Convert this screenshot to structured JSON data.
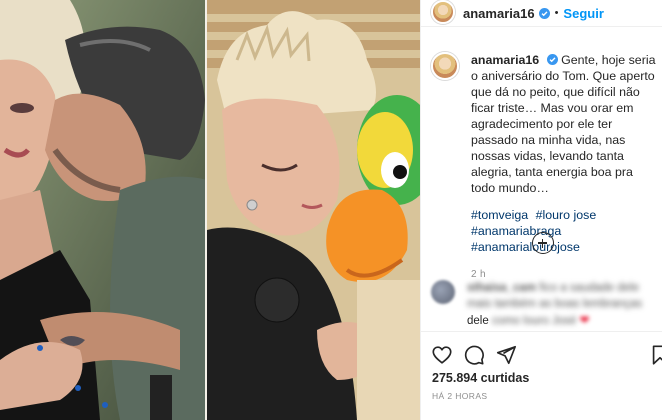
{
  "post": {
    "username": "anamaria16",
    "follow_label": "Seguir",
    "separator": "•"
  },
  "caption": {
    "username": "anamaria16",
    "text": "Gente, hoje seria o aniversário do Tom. Que aperto que dá no peito, que difícil não ficar triste… Mas vou orar em agradecimento por ele ter passado na minha vida, nas nossas vidas, levando tanta alegria, tanta energia boa pra todo mundo…",
    "hashtags": [
      "#tomveiga",
      "#louro jose",
      "#anamariabraga",
      "#anamarialourojose"
    ],
    "time": "2 h"
  },
  "comment": {
    "username": "sthaisa_cam",
    "text_part1": "fico a saudade dele mais também as boas lembranças",
    "text_part2": "dele",
    "text_part3": "como louro José",
    "heart": "❤"
  },
  "stats": {
    "likes": "275.894",
    "likes_label": "curtidas",
    "date": "HÁ 2 HORAS"
  },
  "icons": {
    "verified": "verified-badge-icon",
    "load_more": "add-circle-icon",
    "like": "heart-icon",
    "comment": "comment-icon",
    "share": "send-icon",
    "save": "bookmark-icon"
  },
  "colors": {
    "link_blue": "#0095f6",
    "hashtag": "#00376b",
    "muted": "#8e8e8e"
  }
}
